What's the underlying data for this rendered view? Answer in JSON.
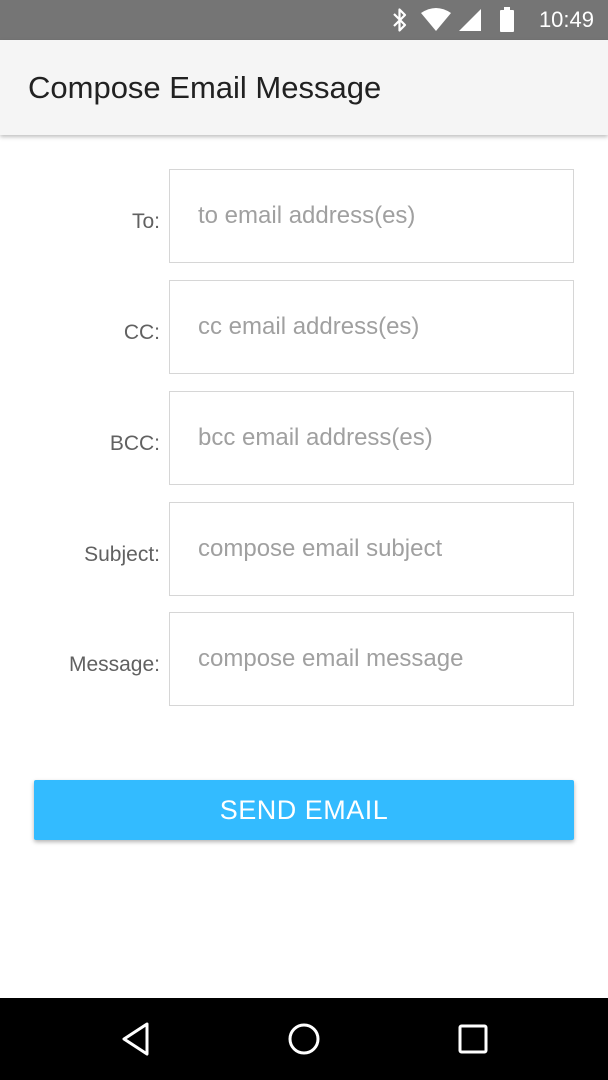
{
  "status_bar": {
    "time": "10:49",
    "icons": [
      "bluetooth-icon",
      "wifi-icon",
      "cell-signal-icon",
      "battery-icon"
    ],
    "background": "#757575"
  },
  "app_bar": {
    "title": "Compose Email Message"
  },
  "form": {
    "fields": [
      {
        "label": "To:",
        "placeholder": "to email address(es)",
        "value": ""
      },
      {
        "label": "CC:",
        "placeholder": "cc email address(es)",
        "value": ""
      },
      {
        "label": "BCC:",
        "placeholder": "bcc email address(es)",
        "value": ""
      },
      {
        "label": "Subject:",
        "placeholder": "compose email subject",
        "value": ""
      },
      {
        "label": "Message:",
        "placeholder": "compose email message",
        "value": ""
      }
    ]
  },
  "send_button": {
    "label": "SEND EMAIL",
    "color": "#33bbff"
  },
  "nav_bar": {
    "buttons": [
      "back-icon",
      "home-icon",
      "recents-icon"
    ]
  }
}
